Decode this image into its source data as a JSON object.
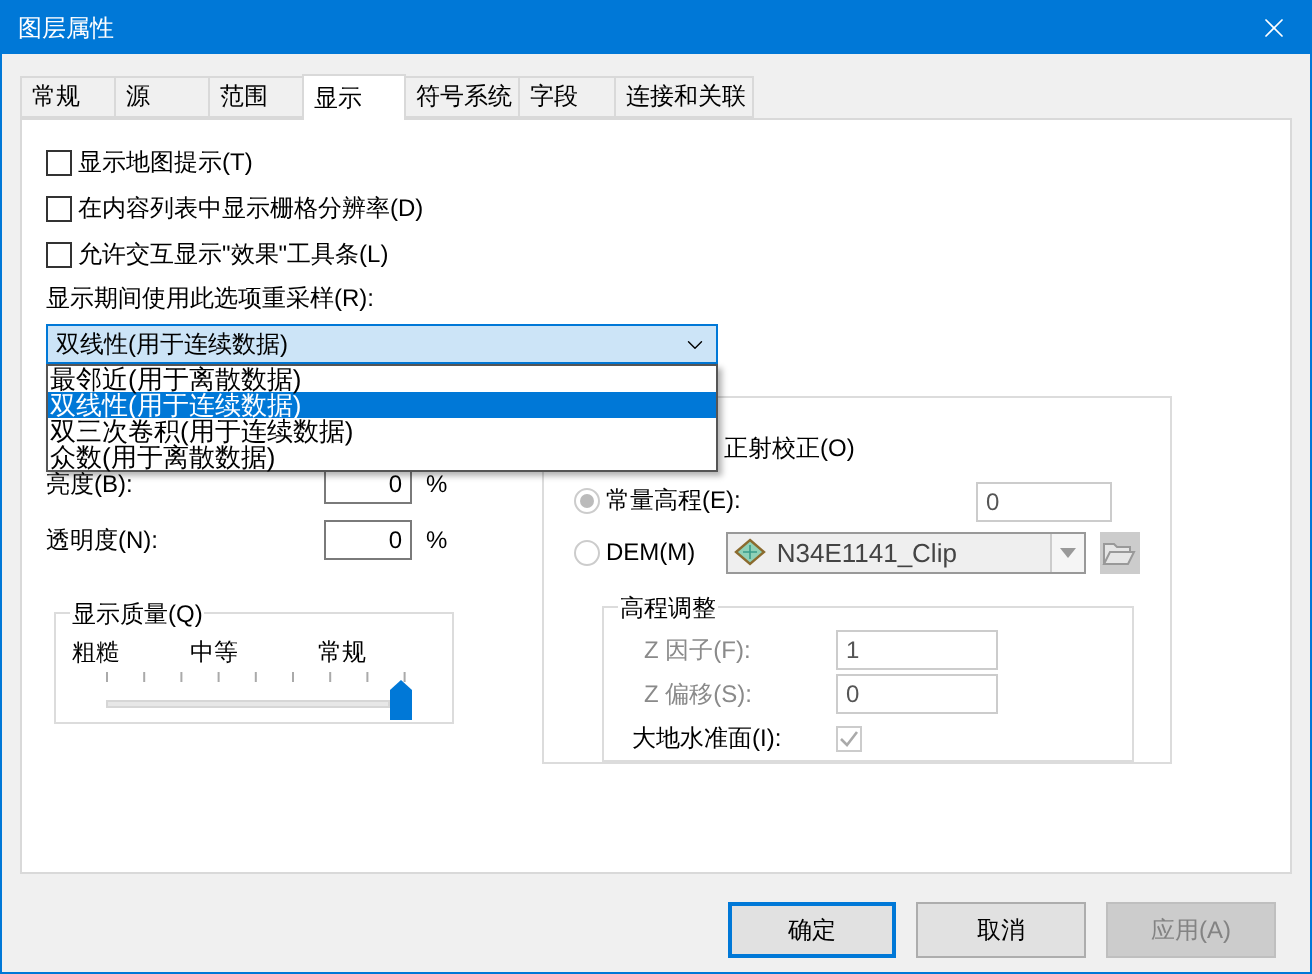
{
  "window": {
    "title": "图层属性"
  },
  "tabs": [
    {
      "label": "常规",
      "selected": false
    },
    {
      "label": "源",
      "selected": false
    },
    {
      "label": "范围",
      "selected": false
    },
    {
      "label": "显示",
      "selected": true
    },
    {
      "label": "符号系统",
      "selected": false
    },
    {
      "label": "字段",
      "selected": false
    },
    {
      "label": "连接和关联",
      "selected": false
    }
  ],
  "checkboxes": [
    {
      "label": "显示地图提示(T)",
      "checked": false
    },
    {
      "label": "在内容列表中显示栅格分辨率(D)",
      "checked": false
    },
    {
      "label": "允许交互显示\"效果\"工具条(L)",
      "checked": false
    }
  ],
  "resample": {
    "label": "显示期间使用此选项重采样(R):",
    "value": "双线性(用于连续数据)",
    "expanded": true,
    "options": [
      {
        "label": "最邻近(用于离散数据)",
        "selected": false
      },
      {
        "label": "双线性(用于连续数据)",
        "selected": true
      },
      {
        "label": "双三次卷积(用于连续数据)",
        "selected": false
      },
      {
        "label": "众数(用于离散数据)",
        "selected": false
      }
    ]
  },
  "adjust_fields": [
    {
      "label": "亮度(B):",
      "value": "0",
      "unit": "%"
    },
    {
      "label": "透明度(N):",
      "value": "0",
      "unit": "%"
    }
  ],
  "display_quality": {
    "title": "显示质量(Q)",
    "labels": [
      "粗糙",
      "中等",
      "常规"
    ],
    "level": 1
  },
  "orthocorrection": {
    "label": "正射校正(O)",
    "disabled": true,
    "sources": [
      {
        "kind": "constant",
        "label": "常量高程(E):",
        "selected": true,
        "value": "0"
      },
      {
        "kind": "dem",
        "label": "DEM(M)",
        "selected": false,
        "value": "N34E1141_Clip"
      }
    ],
    "adjustment": {
      "title": "高程调整",
      "fields": [
        {
          "label": "Z 因子(F):",
          "value": "1"
        },
        {
          "label": "Z 偏移(S):",
          "value": "0"
        }
      ],
      "geoid": {
        "label": "大地水准面(I):",
        "checked": true
      }
    }
  },
  "buttons": [
    {
      "label": "确定",
      "kind": "default"
    },
    {
      "label": "取消",
      "kind": "normal"
    },
    {
      "label": "应用(A)",
      "kind": "disabled"
    }
  ]
}
